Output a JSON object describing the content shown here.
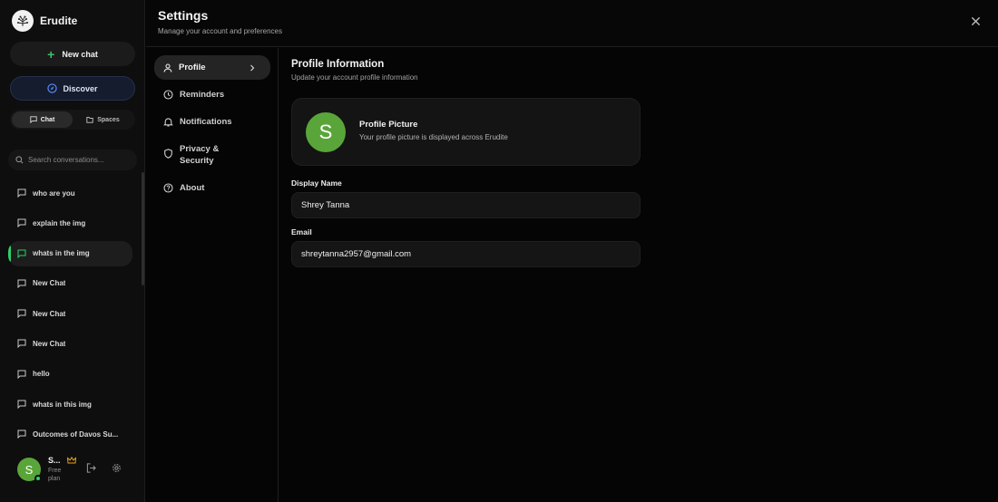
{
  "app": {
    "name": "Erudite"
  },
  "sidebar": {
    "new_chat_label": "New chat",
    "discover_label": "Discover",
    "tabs": [
      {
        "label": "Chat",
        "active": true
      },
      {
        "label": "Spaces",
        "active": false
      }
    ],
    "search_placeholder": "Search conversations...",
    "conversations": [
      {
        "title": "who are you"
      },
      {
        "title": "explain the img"
      },
      {
        "title": "whats in the img",
        "active": true
      },
      {
        "title": "New Chat"
      },
      {
        "title": "New Chat"
      },
      {
        "title": "New Chat"
      },
      {
        "title": "hello"
      },
      {
        "title": "whats in this img"
      },
      {
        "title": "Outcomes of Davos Su..."
      }
    ],
    "user": {
      "initial": "S",
      "name": "S...",
      "plan": "Free plan"
    }
  },
  "settings": {
    "title": "Settings",
    "subtitle": "Manage your account and preferences",
    "nav": [
      {
        "label": "Profile",
        "icon": "user-icon",
        "active": true
      },
      {
        "label": "Reminders",
        "icon": "clock-icon"
      },
      {
        "label": "Notifications",
        "icon": "bell-icon"
      },
      {
        "label": "Privacy & Security",
        "icon": "shield-icon"
      },
      {
        "label": "About",
        "icon": "help-circle-icon"
      }
    ],
    "profile": {
      "title": "Profile Information",
      "subtitle": "Update your account profile information",
      "picture_title": "Profile Picture",
      "picture_subtitle": "Your profile picture is displayed across Erudite",
      "avatar_initial": "S",
      "display_name_label": "Display Name",
      "display_name": "Shrey Tanna",
      "email_label": "Email",
      "email": "shreytanna2957@gmail.com"
    }
  },
  "colors": {
    "accent_green": "#2fd06a",
    "avatar_green": "#5aa53a",
    "crown": "#e0a32a"
  }
}
